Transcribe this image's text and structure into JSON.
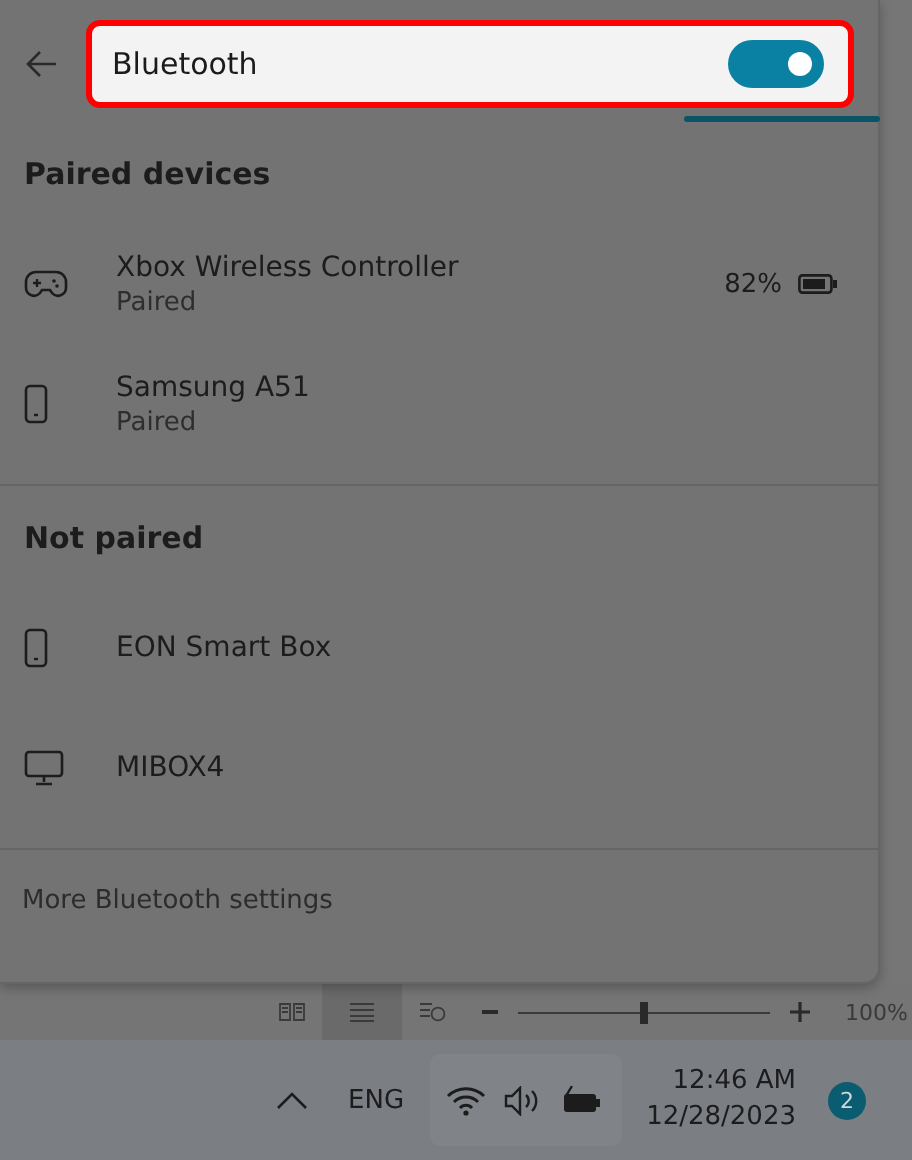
{
  "bluetooth": {
    "label": "Bluetooth",
    "on": true,
    "highlighted": true
  },
  "sections": [
    {
      "title": "Paired devices",
      "devices": [
        {
          "kind": "gamepad",
          "name": "Xbox Wireless Controller",
          "status": "Paired",
          "battery": "82%"
        },
        {
          "kind": "phone",
          "name": "Samsung A51",
          "status": "Paired"
        }
      ]
    },
    {
      "title": "Not paired",
      "devices": [
        {
          "kind": "phone",
          "name": "EON Smart Box"
        },
        {
          "kind": "monitor",
          "name": "MIBOX4"
        }
      ]
    }
  ],
  "footer_link": "More Bluetooth settings",
  "document_status_bar": {
    "zoom_slider": {
      "level": 0.5
    },
    "zoom": "100%"
  },
  "taskbar": {
    "language": "ENG",
    "time": "12:46 AM",
    "date": "12/28/2023",
    "notifications": "2"
  }
}
